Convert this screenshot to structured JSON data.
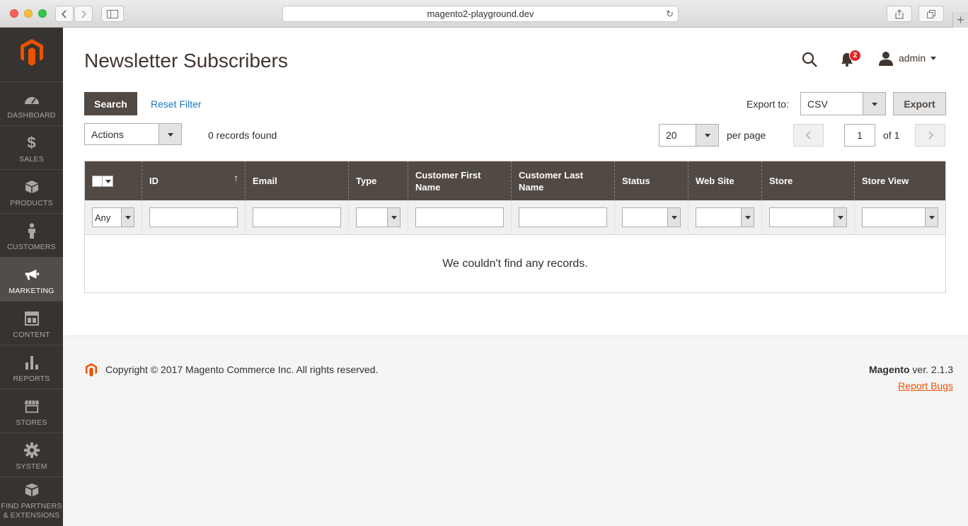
{
  "browser": {
    "url": "magento2-playground.dev"
  },
  "sidebar": {
    "items": [
      {
        "label": "DASHBOARD",
        "icon": "dashboard-icon"
      },
      {
        "label": "SALES",
        "icon": "dollar-icon"
      },
      {
        "label": "PRODUCTS",
        "icon": "box-icon"
      },
      {
        "label": "CUSTOMERS",
        "icon": "person-icon"
      },
      {
        "label": "MARKETING",
        "icon": "megaphone-icon",
        "active": true
      },
      {
        "label": "CONTENT",
        "icon": "layout-icon"
      },
      {
        "label": "REPORTS",
        "icon": "bar-chart-icon"
      },
      {
        "label": "STORES",
        "icon": "storefront-icon"
      },
      {
        "label": "SYSTEM",
        "icon": "gear-icon"
      },
      {
        "label": "FIND PARTNERS",
        "label2": "& EXTENSIONS",
        "icon": "blocks-icon"
      }
    ]
  },
  "header": {
    "title": "Newsletter Subscribers",
    "notification_count": "2",
    "user": "admin"
  },
  "toolbar": {
    "search_label": "Search",
    "reset_label": "Reset Filter",
    "export_to_label": "Export to:",
    "export_format": "CSV",
    "export_label": "Export",
    "actions_label": "Actions",
    "records_found": "0 records found",
    "per_page_value": "20",
    "per_page_label": "per page",
    "current_page": "1",
    "of_pages": "of 1"
  },
  "grid": {
    "columns": [
      "ID",
      "Email",
      "Type",
      "Customer First Name",
      "Customer Last Name",
      "Status",
      "Web Site",
      "Store",
      "Store View"
    ],
    "filter_any": "Any",
    "empty_message": "We couldn't find any records."
  },
  "footer": {
    "copyright": "Copyright © 2017 Magento Commerce Inc. All rights reserved.",
    "brand": "Magento",
    "version": "ver. 2.1.3",
    "report_bugs": "Report Bugs"
  },
  "colors": {
    "sidebar_bg": "#373330",
    "accent": "#eb5202",
    "header_bg": "#514943",
    "link": "#1979c3"
  }
}
